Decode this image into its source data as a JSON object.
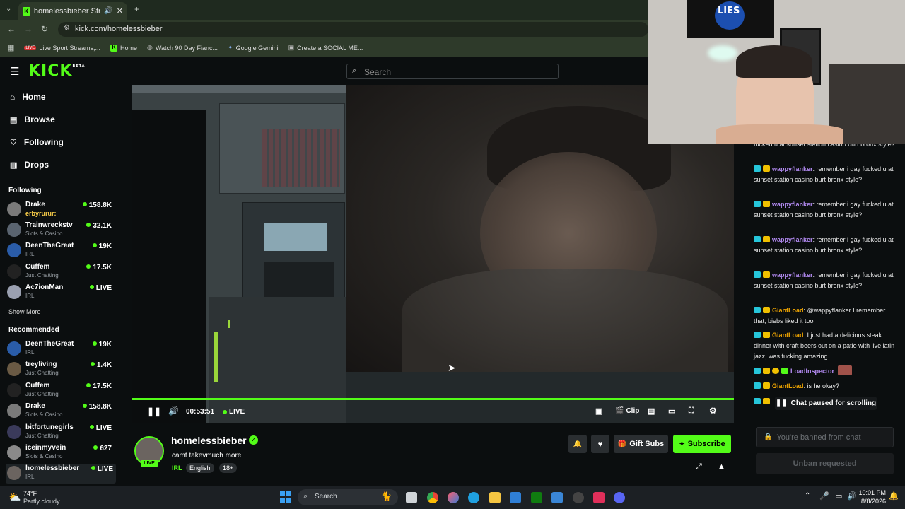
{
  "browser": {
    "tab_title": "homelessbieber Stream - W",
    "url": "kick.com/homelessbieber",
    "bookmarks": [
      "Live Sport Streams,...",
      "Home",
      "Watch 90 Day Fianc...",
      "Google Gemini",
      "Create a SOCIAL ME..."
    ]
  },
  "kick": {
    "logo": "KICK",
    "beta": "BETA",
    "search_placeholder": "Search"
  },
  "sidebar": {
    "nav": [
      "Home",
      "Browse",
      "Following",
      "Drops"
    ],
    "following_label": "Following",
    "following": [
      {
        "name": "Drake",
        "category": "",
        "viewers": "158.8K"
      },
      {
        "name": "Trainwreckstv",
        "category": "Slots & Casino",
        "viewers": "32.1K"
      },
      {
        "name": "DeenTheGreat",
        "category": "IRL",
        "viewers": "19K"
      },
      {
        "name": "Cuffem",
        "category": "Just Chatting",
        "viewers": "17.5K"
      },
      {
        "name": "Ac7ionMan",
        "category": "IRL",
        "viewers": "LIVE"
      }
    ],
    "drake_overlay": "erbyrurur:",
    "show_more": "Show More",
    "recommended_label": "Recommended",
    "recommended": [
      {
        "name": "DeenTheGreat",
        "category": "IRL",
        "viewers": "19K"
      },
      {
        "name": "treyliving",
        "category": "Just Chatting",
        "viewers": "1.4K"
      },
      {
        "name": "Cuffem",
        "category": "Just Chatting",
        "viewers": "17.5K"
      },
      {
        "name": "Drake",
        "category": "Slots & Casino",
        "viewers": "158.8K"
      },
      {
        "name": "bitfortunegirls",
        "category": "Just Chatting",
        "viewers": "LIVE"
      },
      {
        "name": "iceinmyvein",
        "category": "Slots & Casino",
        "viewers": "627"
      },
      {
        "name": "homelessbieber",
        "category": "IRL",
        "viewers": "LIVE"
      }
    ]
  },
  "player": {
    "time": "00:53:51",
    "live_label": "LIVE",
    "clip_label": "Clip",
    "progress": 1.0
  },
  "channel": {
    "name": "homelessbieber",
    "title": "camt takevmuch more",
    "category": "IRL",
    "tags": [
      "English",
      "18+"
    ],
    "live_badge": "LIVE",
    "gift_label": "Gift Subs",
    "subscribe_label": "Subscribe"
  },
  "chat": {
    "messages": [
      {
        "user": "",
        "text": "fucked u at sunset station casino burt bronx style?",
        "color": "#e8e8e8"
      },
      {
        "user": "wappyflanker",
        "text": "remember i gay fucked u at sunset station casino burt bronx style?",
        "color": "#b58cf5"
      },
      {
        "user": "wappyflanker",
        "text": "remember i gay fucked u at sunset station casino burt bronx style?",
        "color": "#b58cf5"
      },
      {
        "user": "wappyflanker",
        "text": "remember i gay fucked u at sunset station casino burt bronx style?",
        "color": "#b58cf5"
      },
      {
        "user": "wappyflanker",
        "text": "remember i gay fucked u at sunset station casino burt bronx style?",
        "color": "#b58cf5"
      },
      {
        "user": "GiantLoad",
        "text": "@wappyflanker I remember that, biebs liked it too",
        "color": "#f0a500"
      },
      {
        "user": "GiantLoad",
        "text": "I just had a delicious steak dinner with craft beers out on a patio with live latin jazz, was fucking amazing",
        "color": "#f0a500"
      },
      {
        "user": "LoadInspector",
        "text": "",
        "color": "#b58cf5"
      },
      {
        "user": "GiantLoad",
        "text": "is he okay?",
        "color": "#f0a500"
      }
    ],
    "paused_label": "Chat paused for scrolling",
    "banned_placeholder": "You're banned from chat",
    "unban_label": "Unban requested"
  },
  "taskbar": {
    "weather_temp": "74°F",
    "weather_desc": "Partly cloudy",
    "search_label": "Search",
    "time": "10:01 PM",
    "date": "8/8/2026"
  },
  "webcam": {
    "flag_text": "LIES"
  }
}
